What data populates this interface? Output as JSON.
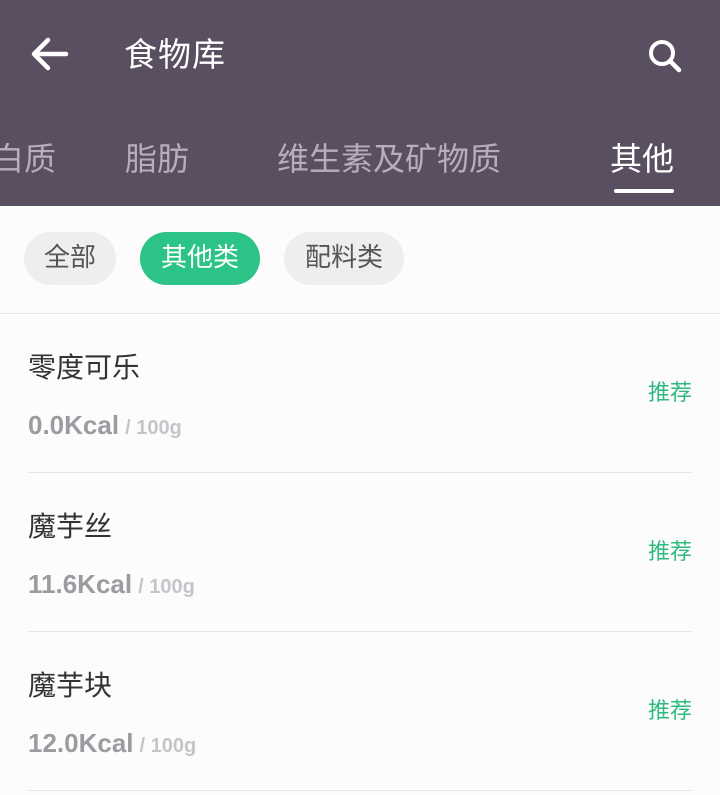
{
  "header": {
    "title": "食物库",
    "back_icon": "back-arrow-icon",
    "search_icon": "search-icon",
    "background": "#5a4f60"
  },
  "tabs": [
    {
      "label": "白质"
    },
    {
      "label": "脂肪"
    },
    {
      "label": "维生素及矿物质"
    },
    {
      "label": "其他",
      "active": true
    }
  ],
  "filters": [
    {
      "label": "全部"
    },
    {
      "label": "其他类",
      "active": true
    },
    {
      "label": "配料类"
    }
  ],
  "accent_color": "#2cc486",
  "foods": [
    {
      "name": "零度可乐",
      "calories": "0.0Kcal",
      "unit": "/ 100g",
      "action": "推荐"
    },
    {
      "name": "魔芋丝",
      "calories": "11.6Kcal",
      "unit": "/ 100g",
      "action": "推荐"
    },
    {
      "name": "魔芋块",
      "calories": "12.0Kcal",
      "unit": "/ 100g",
      "action": "推荐"
    }
  ]
}
